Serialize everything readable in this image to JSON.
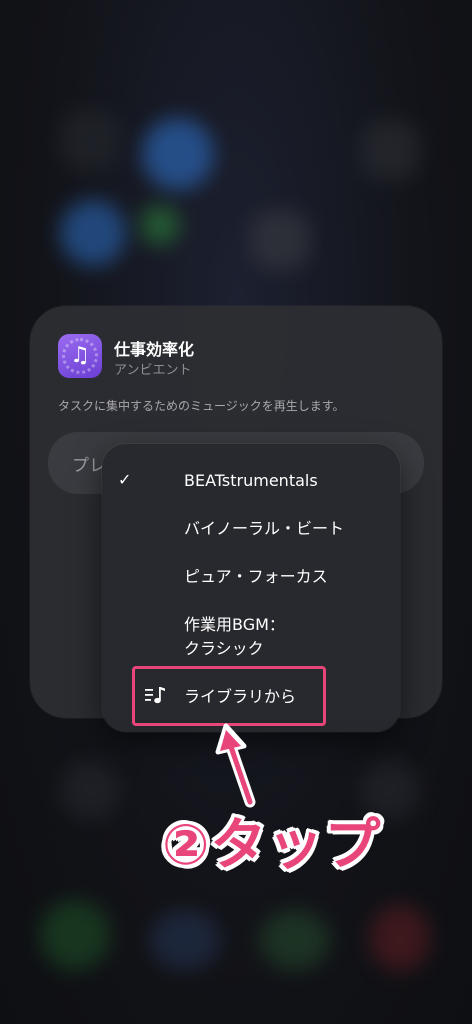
{
  "app": {
    "title": "仕事効率化",
    "subtitle": "アンビエント",
    "description": "タスクに集中するためのミュージックを再生します。",
    "icon": "music-note-icon"
  },
  "play_field": {
    "label": "プレ"
  },
  "menu": {
    "items": [
      {
        "label": "BEATstrumentals",
        "selected": true,
        "icon": "checkmark-icon"
      },
      {
        "label": "バイノーラル・ビート",
        "selected": false
      },
      {
        "label": "ピュア・フォーカス",
        "selected": false
      },
      {
        "label_line1": "作業用BGM：",
        "label_line2": "クラシック",
        "selected": false
      },
      {
        "label": "ライブラリから",
        "selected": false,
        "icon": "library-music-icon"
      }
    ]
  },
  "annotation": {
    "text": "②タップ",
    "color": "#e8457a"
  },
  "colors": {
    "accent": "#e8457a",
    "app_icon": "#7d4fe0",
    "modal_bg": "#2c2d32",
    "menu_bg": "#28292e"
  }
}
